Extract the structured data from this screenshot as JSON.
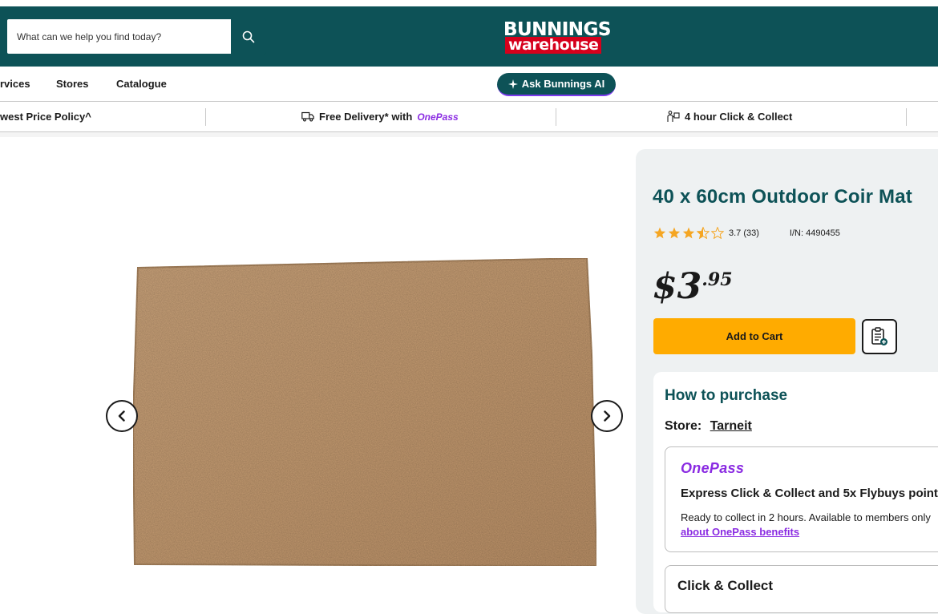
{
  "header": {
    "search_placeholder": "What can we help you find today?",
    "logo_top": "BUNNINGS",
    "logo_bottom": "warehouse",
    "brand_color": "#0d5257",
    "accent_red": "#d6001c"
  },
  "nav": {
    "items": [
      "rvices",
      "Stores",
      "Catalogue"
    ],
    "ask_ai_label": "Ask Bunnings AI"
  },
  "usp": {
    "price_policy": "west Price Policy^",
    "delivery_prefix": "Free Delivery* with",
    "delivery_onepass": "OnePass",
    "click_collect": "4 hour Click & Collect"
  },
  "product": {
    "title": "40 x 60cm Outdoor Coir Mat",
    "rating": 3.7,
    "rating_text": "3.7 (33)",
    "item_number": "I/N: 4490455",
    "price_dollars": "$3",
    "price_cents": ".95",
    "add_to_cart_label": "Add to Cart",
    "cart_button_color": "#ffab00"
  },
  "purchase": {
    "heading": "How to purchase",
    "store_label": "Store:",
    "store_name": "Tarneit",
    "onepass_logo": "OnePass",
    "express_text": "Express Click & Collect and 5x Flybuys point",
    "ready_text": "Ready to collect in 2 hours. Available to members only",
    "about_link": "about OnePass benefits",
    "click_collect_title": "Click & Collect"
  },
  "icons": {
    "search": "search-icon",
    "sparkle": "sparkle-icon",
    "truck": "delivery-truck-icon",
    "collect": "click-collect-icon",
    "prev": "chevron-left-icon",
    "next": "chevron-right-icon",
    "list": "add-to-list-icon",
    "star": "star-icon"
  }
}
